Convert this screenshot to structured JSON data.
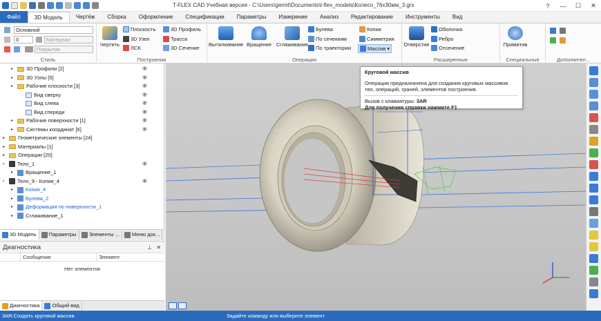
{
  "window": {
    "title": "T-FLEX CAD Учебная версия - C:\\Users\\germt\\Documents\\t-flex_models\\Колесо_76х30мм_3.grs"
  },
  "tabs": [
    "Файл",
    "3D Модель",
    "Чертёж",
    "Сборка",
    "Оформление",
    "Спецификации",
    "Параметры",
    "Измерение",
    "Анализ",
    "Редактирование",
    "Инструменты",
    "Вид"
  ],
  "ribbon": {
    "style": {
      "combo1": "Основной",
      "combo2": "0",
      "combo3": "Материал",
      "combo4": "Покрытие",
      "label": "Стиль"
    },
    "construct": {
      "sketch": "Чертить",
      "plane": "Плоскость",
      "node3d": "3D Узел",
      "lsk": "ЛСК",
      "profile3d": "3D Профиль",
      "path": "Трасса",
      "section3d": "3D Сечение",
      "label": "Построения"
    },
    "ops": {
      "extrude": "Выталкивание",
      "revolve": "Вращение",
      "smooth": "Сглаживание",
      "boolean": "Булева",
      "sections": "По сечениям",
      "trajectory": "По траектории",
      "copy": "Копия",
      "symmetry": "Симметрия",
      "array": "Массив",
      "label": "Операции"
    },
    "adv": {
      "hole": "Отверстие",
      "shell": "Оболочка",
      "rib": "Ребро",
      "cut": "Отсечение",
      "label": "Расширенные"
    },
    "special": {
      "primitives": "Примитив",
      "label": "Специальные"
    },
    "extra": {
      "label": "Дополнител..."
    }
  },
  "tree": [
    {
      "label": "3D Профили [2]",
      "indent": 1,
      "kind": "folder",
      "eye": true
    },
    {
      "label": "3D Узлы [5]",
      "indent": 1,
      "kind": "folder",
      "eye": true
    },
    {
      "label": "Рабочие плоскости [3]",
      "indent": 1,
      "kind": "folder",
      "eye": true
    },
    {
      "label": "Вид сверху",
      "indent": 2,
      "kind": "doc",
      "eye": true
    },
    {
      "label": "Вид слева",
      "indent": 2,
      "kind": "doc",
      "eye": true
    },
    {
      "label": "Вид спереди",
      "indent": 2,
      "kind": "doc",
      "eye": true
    },
    {
      "label": "Рабочие поверхности [1]",
      "indent": 1,
      "kind": "folder",
      "eye": true
    },
    {
      "label": "Системы координат [6]",
      "indent": 1,
      "kind": "folder",
      "eye": true
    },
    {
      "label": "Геометрические элементы [24]",
      "indent": 0,
      "kind": "folder",
      "eye": false
    },
    {
      "label": "Материалы [1]",
      "indent": 0,
      "kind": "folder",
      "eye": false
    },
    {
      "label": "Операции [20]",
      "indent": 0,
      "kind": "folder",
      "eye": false
    },
    {
      "label": "Тело_1",
      "indent": 0,
      "kind": "body",
      "eye": true
    },
    {
      "label": "Вращение_1",
      "indent": 1,
      "kind": "op",
      "eye": false
    },
    {
      "label": "Тело_9 - Копия_4",
      "indent": 0,
      "kind": "body",
      "eye": true
    },
    {
      "label": "Копия_4",
      "indent": 1,
      "kind": "op",
      "eye": false,
      "blue": true
    },
    {
      "label": "Булева_2",
      "indent": 1,
      "kind": "op",
      "eye": false,
      "blue": true
    },
    {
      "label": "Деформация по поверхности_1",
      "indent": 1,
      "kind": "op",
      "eye": false,
      "blue": true
    },
    {
      "label": "Сглаживание_1",
      "indent": 1,
      "kind": "op",
      "eye": false
    }
  ],
  "panel_tabs": [
    "3D Модель",
    "Параметры",
    "Элементы ...",
    "Меню док..."
  ],
  "diagnostics": {
    "title": "Диагностика",
    "col_message": "Сообщение",
    "col_element": "Элемент",
    "empty": "Нет элементов"
  },
  "bottom_tabs": [
    "Диагностика",
    "Общий вид"
  ],
  "tooltip": {
    "title": "Круговой массив",
    "desc": "Операция предназначена для создания круговых массивов тел, операций, граней, элементов построения.",
    "shortcut_label": "Вызов с клавиатуры:",
    "shortcut": "3AR",
    "help": "Для получения справки нажмите F1"
  },
  "status": {
    "left": "3AR:Создать круговой массив",
    "center": "Задайте команду или выберите элемент"
  },
  "colors": {
    "accent": "#2b6bbd",
    "selection": "#1c63c7"
  }
}
